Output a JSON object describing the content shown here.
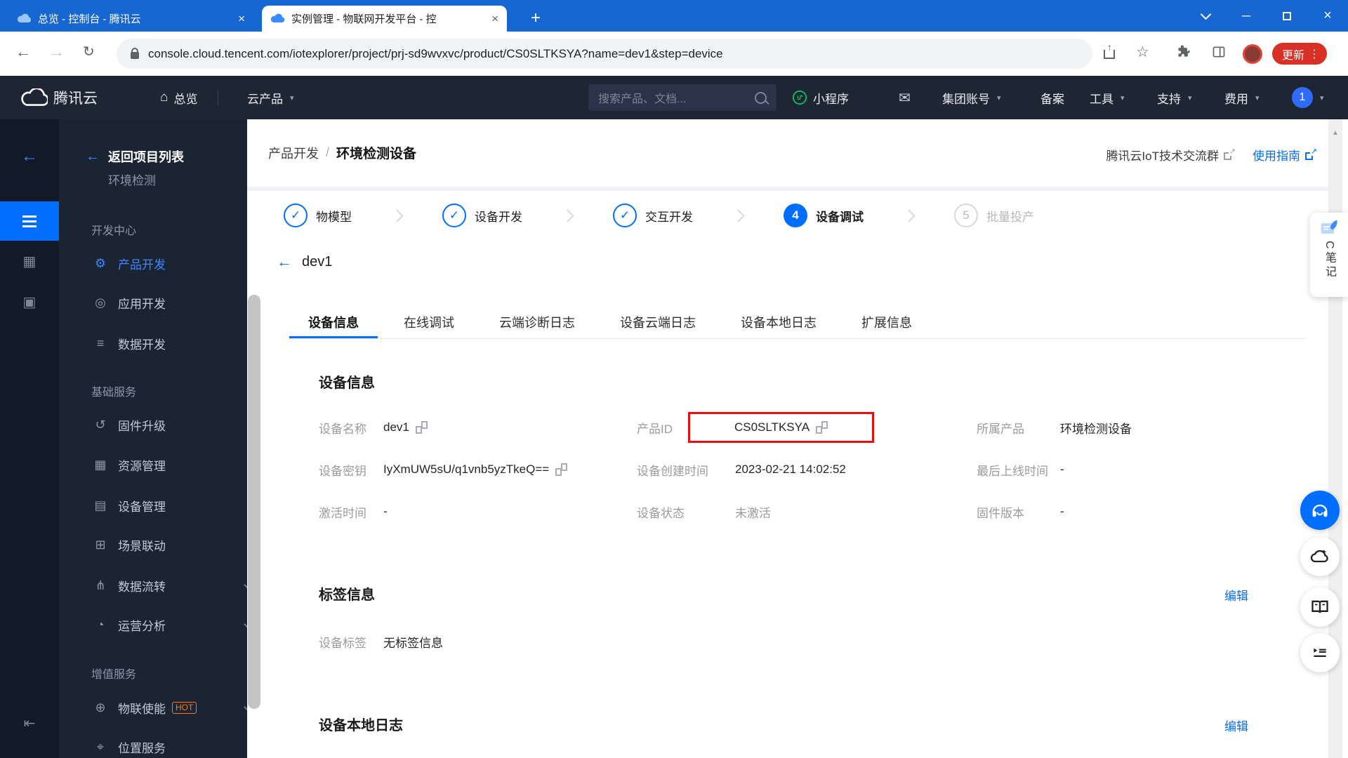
{
  "browser": {
    "tab1_title": "总览 - 控制台 - 腾讯云",
    "tab2_title": "实例管理 - 物联网开发平台 - 控",
    "url": "console.cloud.tencent.com/iotexplorer/project/prj-sd9wvxvc/product/CS0SLTKSYA?name=dev1&step=device",
    "update_label": "更新"
  },
  "topnav": {
    "brand": "腾讯云",
    "overview": "总览",
    "cloud_products": "云产品",
    "search_placeholder": "搜索产品、文档...",
    "mini_program": "小程序",
    "group_account": "集团账号",
    "icp": "备案",
    "tools": "工具",
    "support": "支持",
    "billing": "费用",
    "avatar": "1"
  },
  "sidebar": {
    "back_label": "返回项目列表",
    "project_name": "环境检测",
    "sec_dev": "开发中心",
    "product_dev": "产品开发",
    "app_dev": "应用开发",
    "data_dev": "数据开发",
    "sec_basic": "基础服务",
    "firmware": "固件升级",
    "resource": "资源管理",
    "device_mgmt": "设备管理",
    "scene": "场景联动",
    "data_flow": "数据流转",
    "ops": "运营分析",
    "sec_vas": "增值服务",
    "iot_enable": "物联使能",
    "hot": "HOT",
    "location": "位置服务"
  },
  "header": {
    "breadcrumb_parent": "产品开发",
    "breadcrumb_sep": "/",
    "breadcrumb_current": "环境检测设备",
    "community": "腾讯云IoT技术交流群",
    "guide": "使用指南"
  },
  "steps": {
    "s1": "物模型",
    "s2": "设备开发",
    "s3": "交互开发",
    "s4": "设备调试",
    "s4_num": "4",
    "s5": "批量投产",
    "s5_num": "5"
  },
  "device": {
    "name": "dev1",
    "tabs": [
      "设备信息",
      "在线调试",
      "云端诊断日志",
      "设备云端日志",
      "设备本地日志",
      "扩展信息"
    ],
    "info_title": "设备信息",
    "name_label": "设备名称",
    "name_value": "dev1",
    "product_id_label": "产品ID",
    "product_id_value": "CS0SLTKSYA",
    "product_label": "所属产品",
    "product_value": "环境检测设备",
    "secret_label": "设备密钥",
    "secret_value": "IyXmUW5sU/q1vnb5yzTkeQ==",
    "created_label": "设备创建时间",
    "created_value": "2023-02-21 14:02:52",
    "last_online_label": "最后上线时间",
    "last_online_value": "-",
    "activated_label": "激活时间",
    "activated_value": "-",
    "status_label": "设备状态",
    "status_value": "未激活",
    "firmware_label": "固件版本",
    "firmware_value": "-",
    "tag_title": "标签信息",
    "tag_label": "设备标签",
    "tag_value": "无标签信息",
    "edit": "编辑",
    "local_log_title": "设备本地日志"
  },
  "floating": {
    "note": "C笔记"
  },
  "icons": {
    "home": "⌂",
    "mail": "✉",
    "caret": "▾",
    "star": "☆",
    "back_arrow": "←",
    "forward_arrow": "→",
    "reload": "↻",
    "plus": "+",
    "close": "×",
    "minimize": "─",
    "check": "✓",
    "menu_dots": "⋮",
    "scroll_up": "▲",
    "rail_grid": "▦",
    "rail_panel": "▣",
    "rail_collapse": "⇤",
    "gear": "⚙",
    "app_circle": "◎",
    "data_lines": "≡",
    "firmware_loop": "↺",
    "resource_grid": "▦",
    "device_list": "▤",
    "scene_link": "⊞",
    "flow_branch": "⋔",
    "ops_chart": "◔",
    "enable_globe": "⊕",
    "location_pin": "⌖"
  },
  "colors": {
    "accent": "#006eff",
    "highlight_red": "#e60f0f",
    "hot_orange": "#ff7800",
    "chrome_blue": "#1667d1"
  }
}
